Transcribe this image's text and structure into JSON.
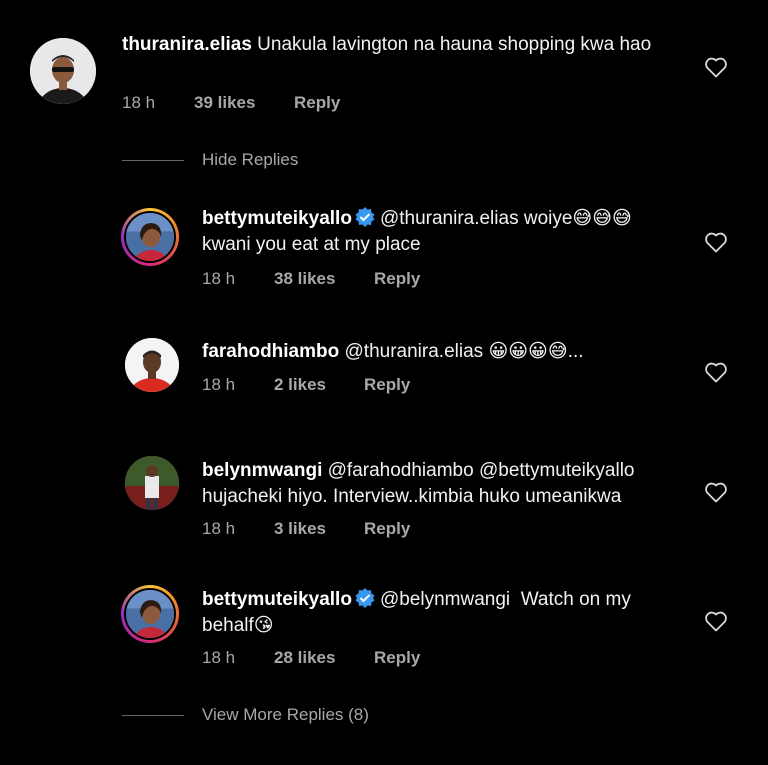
{
  "comments": [
    {
      "username": "thuranira.elias",
      "text": "Unakula lavington na hauna shopping kwa hao",
      "time": "18 h",
      "likes": "39 likes",
      "reply": "Reply",
      "verified": false,
      "avatar_icon": "profile-photo-man-sunglasses"
    }
  ],
  "hide_replies": "Hide Replies",
  "replies": [
    {
      "username": "bettymuteikyallo",
      "mention": "@thuranira.elias",
      "text_line1": "woiye😅😅😅",
      "text_line2": "kwani you eat at my place",
      "time": "18 h",
      "likes": "38 likes",
      "reply": "Reply",
      "verified": true,
      "avatar_icon": "profile-photo-woman"
    },
    {
      "username": "farahodhiambo",
      "mention": "@thuranira.elias",
      "text_line1": "😀😀😀😅...",
      "time": "18 h",
      "likes": "2 likes",
      "reply": "Reply",
      "verified": false,
      "avatar_icon": "profile-photo-man-red-shirt"
    },
    {
      "username": "belynmwangi",
      "mention": "@farahodhiambo @bettymuteikyallo",
      "text_line2": "hujacheki hiyo. Interview..kimbia huko umeanikwa",
      "time": "18 h",
      "likes": "3 likes",
      "reply": "Reply",
      "verified": false,
      "avatar_icon": "profile-photo-person-outdoors"
    },
    {
      "username": "bettymuteikyallo",
      "mention": "@belynmwangi",
      "text_line1": "Watch on my",
      "text_line2": "behalf😘",
      "time": "18 h",
      "likes": "28 likes",
      "reply": "Reply",
      "verified": true,
      "avatar_icon": "profile-photo-woman"
    }
  ],
  "view_more_replies": "View More Replies (8)",
  "colors": {
    "background": "#000000",
    "meta_text": "#a8a8a8",
    "verified_badge": "#3897f0"
  }
}
